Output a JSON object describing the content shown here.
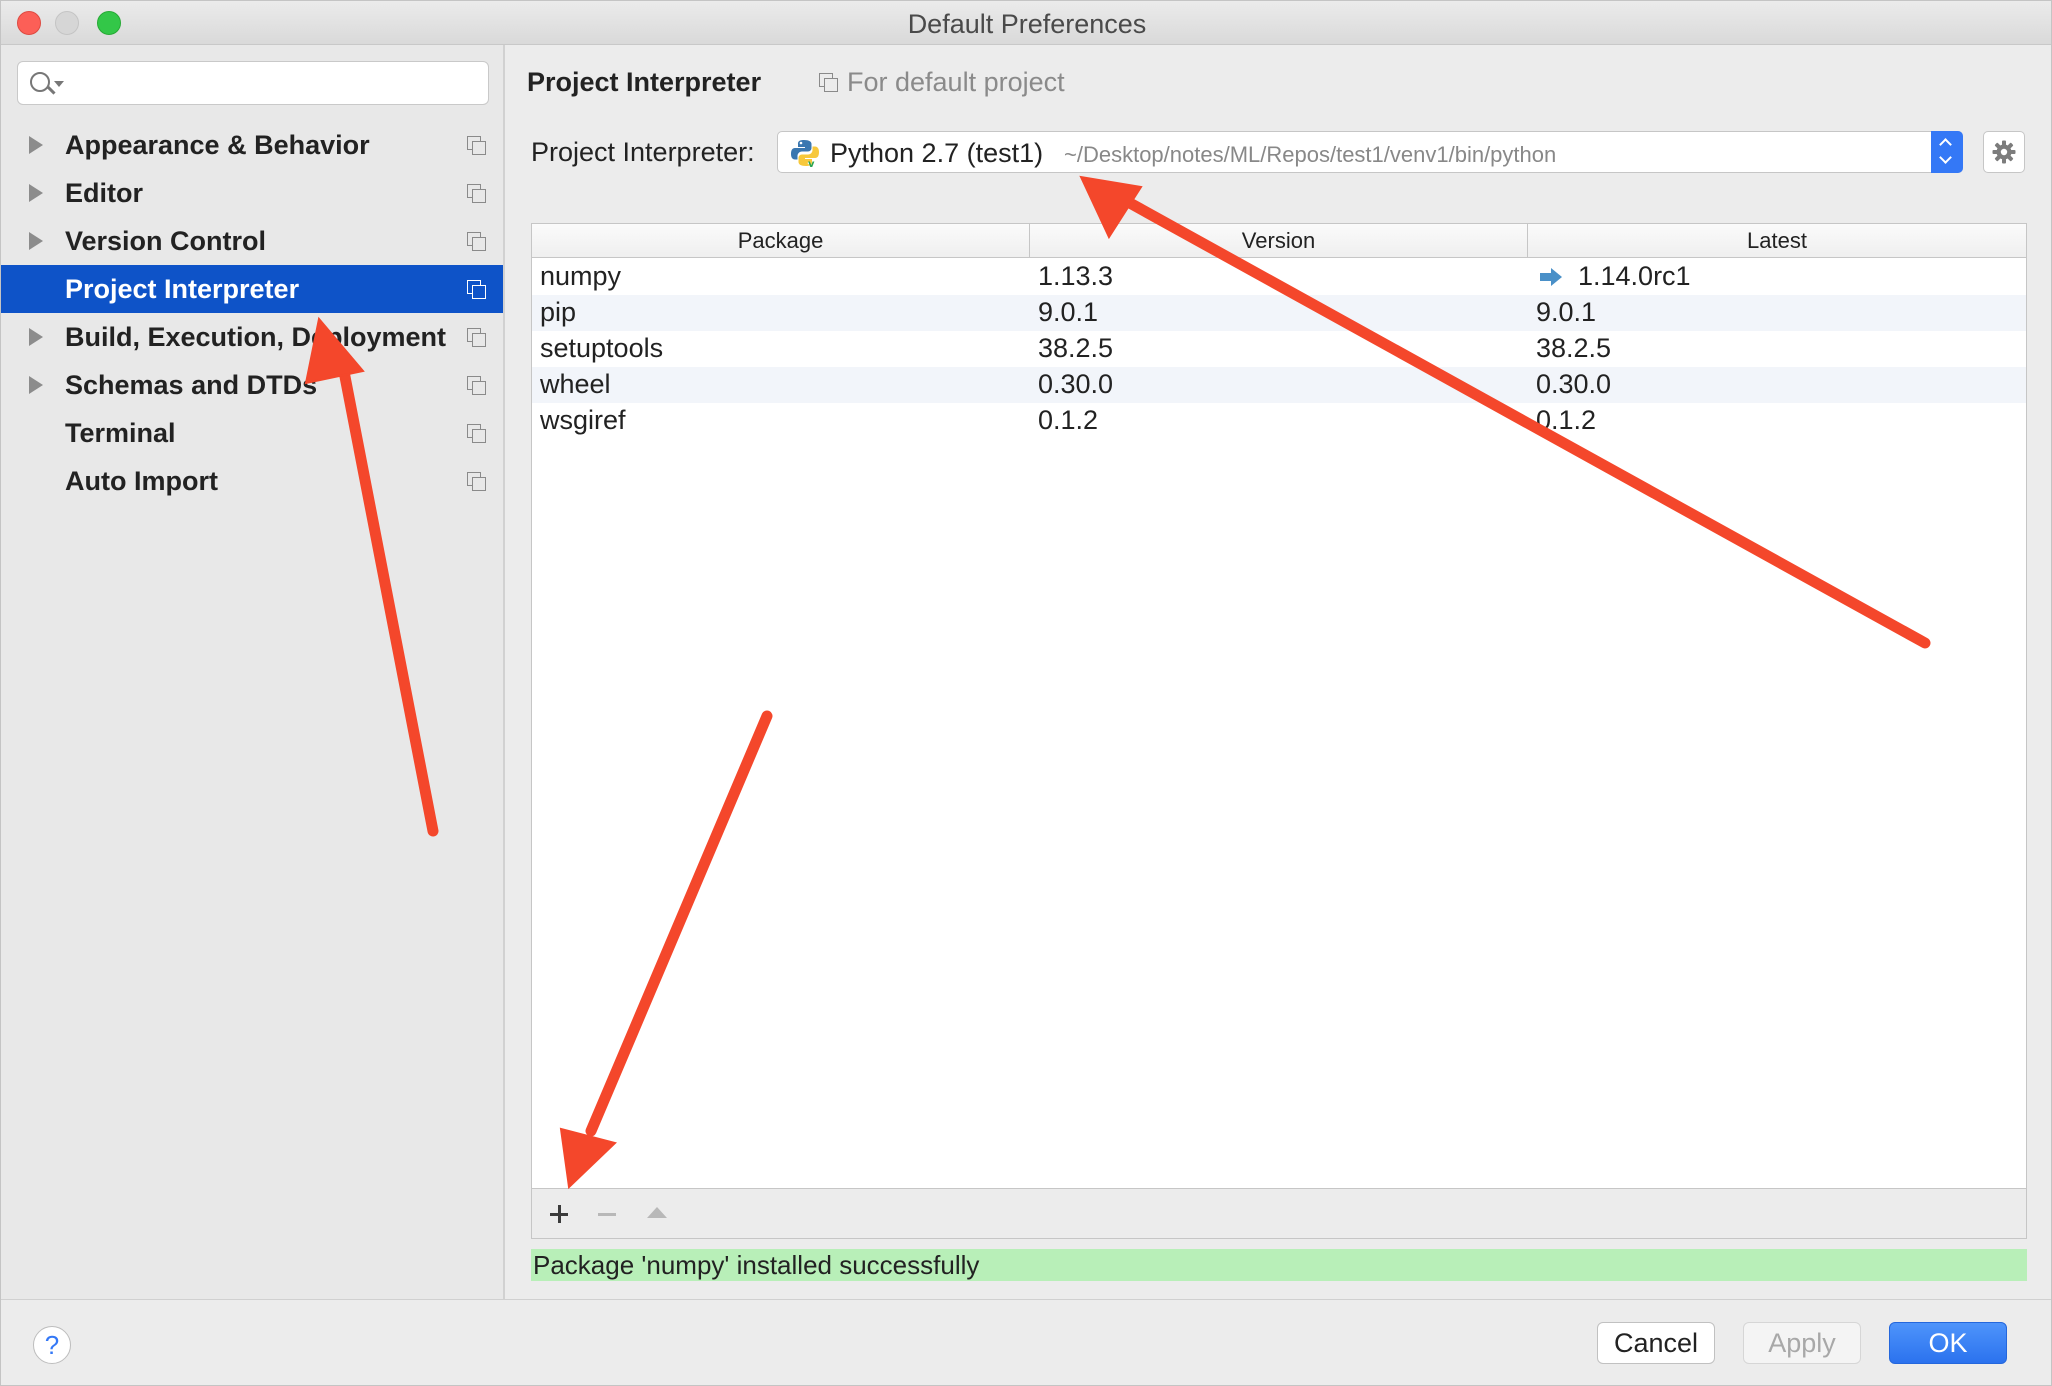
{
  "window": {
    "title": "Default Preferences"
  },
  "search": {
    "placeholder": "",
    "value": ""
  },
  "sidebar": {
    "items": [
      {
        "label": "Appearance & Behavior",
        "expandable": true,
        "active": false
      },
      {
        "label": "Editor",
        "expandable": true,
        "active": false
      },
      {
        "label": "Version Control",
        "expandable": true,
        "active": false
      },
      {
        "label": "Project Interpreter",
        "expandable": false,
        "active": true
      },
      {
        "label": "Build, Execution, Deployment",
        "expandable": true,
        "active": false
      },
      {
        "label": "Schemas and DTDs",
        "expandable": true,
        "active": false
      },
      {
        "label": "Terminal",
        "expandable": false,
        "active": false
      },
      {
        "label": "Auto Import",
        "expandable": false,
        "active": false
      }
    ]
  },
  "main": {
    "title": "Project Interpreter",
    "scope_label": "For default project",
    "interpreter_label": "Project Interpreter:",
    "interpreter_name": "Python 2.7 (test1)",
    "interpreter_path": "~/Desktop/notes/ML/Repos/test1/venv1/bin/python"
  },
  "table": {
    "headers": {
      "package": "Package",
      "version": "Version",
      "latest": "Latest"
    },
    "rows": [
      {
        "package": "numpy",
        "version": "1.13.3",
        "latest": "1.14.0rc1",
        "upgrade_available": true
      },
      {
        "package": "pip",
        "version": "9.0.1",
        "latest": "9.0.1",
        "upgrade_available": false
      },
      {
        "package": "setuptools",
        "version": "38.2.5",
        "latest": "38.2.5",
        "upgrade_available": false
      },
      {
        "package": "wheel",
        "version": "0.30.0",
        "latest": "0.30.0",
        "upgrade_available": false
      },
      {
        "package": "wsgiref",
        "version": "0.1.2",
        "latest": "0.1.2",
        "upgrade_available": false
      }
    ]
  },
  "status": {
    "message": "Package 'numpy' installed successfully"
  },
  "footer": {
    "help_label": "?",
    "cancel_label": "Cancel",
    "apply_label": "Apply",
    "ok_label": "OK"
  },
  "colors": {
    "selection": "#0e53c8",
    "status_success_bg": "#b8efb8",
    "annotation_arrow": "#f4472b",
    "primary_button": "#2b72ee"
  },
  "icons": {
    "search": "search-icon",
    "expand": "chevron-right-icon",
    "project_scope": "copy-icon",
    "python": "python-icon",
    "settings": "gear-icon",
    "upgrade": "upgrade-arrow-icon",
    "add": "plus-icon",
    "remove": "minus-icon",
    "upgrade_package": "triangle-up-icon"
  }
}
